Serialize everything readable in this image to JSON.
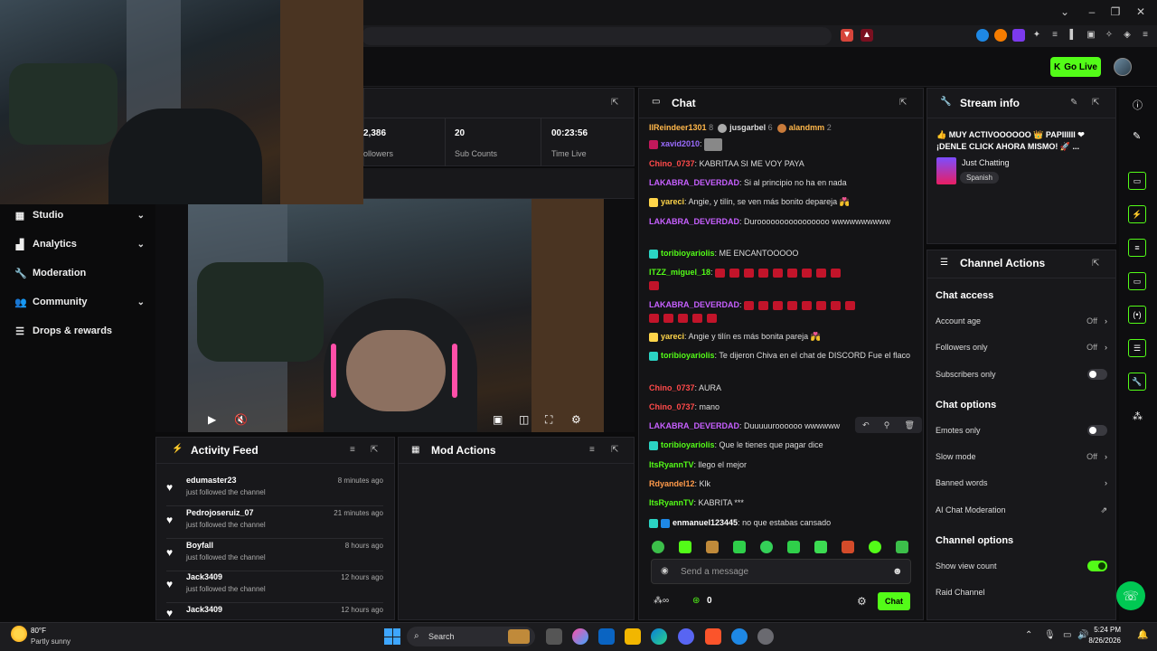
{
  "header": {
    "go_live": "Go Live"
  },
  "sidebar": {
    "items": [
      {
        "label": "Studio",
        "icon": "grid-icon",
        "expandable": true
      },
      {
        "label": "Analytics",
        "icon": "chart-icon",
        "expandable": true
      },
      {
        "label": "Moderation",
        "icon": "wrench-icon",
        "expandable": false
      },
      {
        "label": "Community",
        "icon": "people-icon",
        "expandable": true
      },
      {
        "label": "Drops & rewards",
        "icon": "stack-icon",
        "expandable": false
      }
    ]
  },
  "stats": [
    {
      "value": "2,386",
      "label": "ollowers"
    },
    {
      "value": "20",
      "label": "Sub Counts"
    },
    {
      "value": "00:23:56",
      "label": "Time Live"
    }
  ],
  "activity": {
    "title": "Activity Feed",
    "items": [
      {
        "name": "edumaster23",
        "sub": "just followed the channel",
        "time": "8 minutes ago"
      },
      {
        "name": "Pedrojoseruiz_07",
        "sub": "just followed the channel",
        "time": "21 minutes ago"
      },
      {
        "name": "Boyfall",
        "sub": "just followed the channel",
        "time": "8 hours ago"
      },
      {
        "name": "Jack3409",
        "sub": "just followed the channel",
        "time": "12 hours ago"
      },
      {
        "name": "Jack3409",
        "sub": "",
        "time": "12 hours ago"
      }
    ]
  },
  "mod_actions": {
    "title": "Mod Actions"
  },
  "chat": {
    "title": "Chat",
    "leaderboard": [
      {
        "name": "IlReindeer1301",
        "count": "8"
      },
      {
        "name": "jusgarbel",
        "count": "6",
        "rank": "2"
      },
      {
        "name": "alandmm",
        "count": "2",
        "rank": "3"
      }
    ],
    "messages": [
      {
        "user": "xavid2010",
        "text": "",
        "color": "#9b6cff"
      },
      {
        "user": "Chino_0737",
        "text": "KABRITAA SI ME VOY PAYA",
        "color": "#ff4a4a"
      },
      {
        "user": "LAKABRA_DEVERDAD",
        "text": "Si al principio no ha en nada",
        "color": "#c760ff"
      },
      {
        "user": "yareci",
        "text": "Angie, y tilín, se ven más bonito depareja 💏",
        "color": "#ffd54a"
      },
      {
        "user": "LAKABRA_DEVERDAD",
        "text": "Duroooooooooooooooo wwwwwwwwww",
        "color": "#c760ff"
      },
      {
        "user": "toribioyariolis",
        "text": "ME ENCANTOOOOO",
        "color": "#53fc18"
      },
      {
        "user": "ITZZ_miguel_18",
        "text": "",
        "color": "#53fc18"
      },
      {
        "user": "LAKABRA_DEVERDAD",
        "text": "",
        "color": "#c760ff"
      },
      {
        "user": "yareci",
        "text": "Angie y tilín es más bonita pareja 💏",
        "color": "#ffd54a"
      },
      {
        "user": "toribioyariolis",
        "text": "Te dijeron Chiva en el chat de DISCORD Fue el flaco",
        "color": "#53fc18"
      },
      {
        "user": "Chino_0737",
        "text": "AURA",
        "color": "#ff4a4a"
      },
      {
        "user": "Chino_0737",
        "text": "mano",
        "color": "#ff4a4a"
      },
      {
        "user": "LAKABRA_DEVERDAD",
        "text": "Duuuuuroooooo wwwwww",
        "color": "#c760ff"
      },
      {
        "user": "toribioyariolis",
        "text": "Que le tienes que pagar dice",
        "color": "#53fc18"
      },
      {
        "user": "ItsRyannTV",
        "text": "llego el mejor",
        "color": "#53fc18"
      },
      {
        "user": "Rdyandel12",
        "text": "Klk",
        "color": "#ff9a4a"
      },
      {
        "user": "ItsRyannTV",
        "text": "KABRITA ***",
        "color": "#53fc18"
      },
      {
        "user": "enmanuel123445",
        "text": "no que estabas cansado",
        "color": "#fff"
      }
    ],
    "input_placeholder": "Send a message",
    "send_label": "Chat",
    "footer_count": "0"
  },
  "stream_info": {
    "title": "Stream info",
    "stream_title": "👍 MUY ACTIVOOOOOO 👑 PAPIIIIII ❤ ¡DENLE CLICK AHORA MISMO! 🚀 ...",
    "category": "Just Chatting",
    "language": "Spanish"
  },
  "channel_actions": {
    "title": "Channel Actions",
    "chat_access_title": "Chat access",
    "account_age": "Account age",
    "account_age_val": "Off",
    "followers_only": "Followers only",
    "followers_only_val": "Off",
    "subscribers_only": "Subscribers only",
    "chat_options_title": "Chat options",
    "emotes_only": "Emotes only",
    "slow_mode": "Slow mode",
    "slow_mode_val": "Off",
    "banned_words": "Banned words",
    "ai_moderation": "AI Chat Moderation",
    "channel_options_title": "Channel options",
    "show_view_count": "Show view count",
    "raid_channel": "Raid Channel"
  },
  "taskbar": {
    "weather_temp": "80°F",
    "weather_desc": "Partly sunny",
    "search": "Search",
    "time": "5:24 PM",
    "date": "8/26/2026"
  },
  "colors": {
    "accent": "#53fc18",
    "panel": "#18181b"
  }
}
